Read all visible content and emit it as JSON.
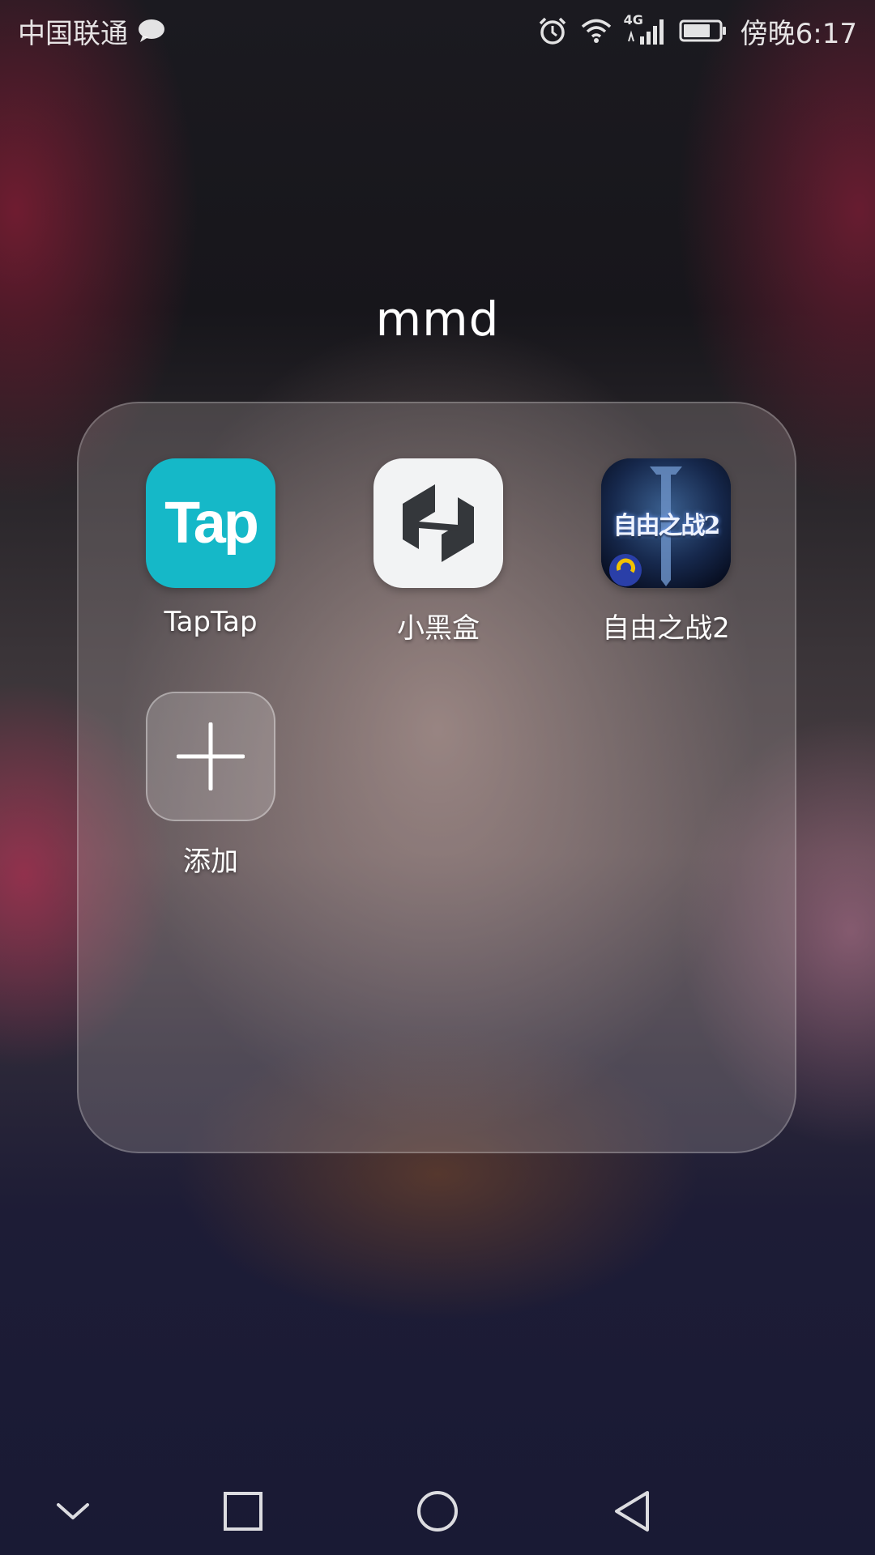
{
  "status_bar": {
    "carrier": "中国联通",
    "message_icon": "chat-bubble-icon",
    "network_type": "4G",
    "time": "傍晚6:17",
    "icons": [
      "alarm-icon",
      "wifi-icon",
      "signal-icon",
      "battery-icon"
    ]
  },
  "folder": {
    "title": "mmd",
    "apps": [
      {
        "label": "TapTap",
        "icon": "taptap-app-icon",
        "icon_text": "Tap",
        "icon_bg": "#15b8c8"
      },
      {
        "label": "小黑盒",
        "icon": "heybox-app-icon",
        "icon_bg": "#f2f3f4"
      },
      {
        "label": "自由之战2",
        "icon": "game-app-icon",
        "icon_text": "自由之战2",
        "icon_bg": "#0f1a36"
      }
    ],
    "add": {
      "label": "添加",
      "icon": "plus-icon"
    }
  },
  "nav_bar": {
    "buttons": [
      "chevron-down-icon",
      "recents-square-icon",
      "home-circle-icon",
      "back-triangle-icon"
    ]
  }
}
